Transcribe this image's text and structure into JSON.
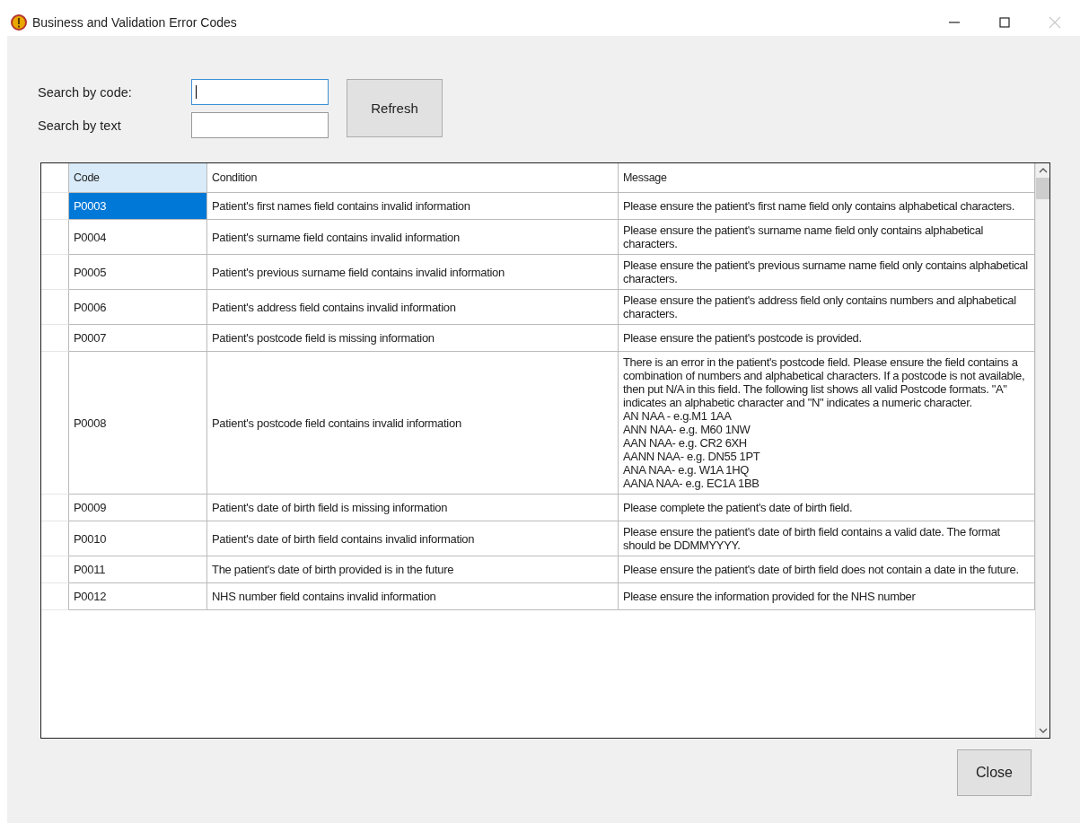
{
  "window": {
    "title": "Business and Validation Error Codes"
  },
  "search": [
    {
      "label": "Search by code:",
      "focused": true
    },
    {
      "label": "Search by text",
      "focused": false
    }
  ],
  "refresh_button": "Refresh",
  "table": {
    "columns": [
      {
        "label": "Code",
        "selected": true
      },
      {
        "label": "Condition",
        "selected": false
      },
      {
        "label": "Message",
        "selected": false
      }
    ],
    "rows": [
      {
        "code": "P0003",
        "condition": "Patient's first names field contains invalid information",
        "message": "Please ensure the patient's first name field only contains alphabetical characters.",
        "selected": true
      },
      {
        "code": "P0004",
        "condition": "Patient's surname field contains invalid information",
        "message": "Please ensure the patient's surname name field only contains alphabetical characters.",
        "selected": false
      },
      {
        "code": "P0005",
        "condition": "Patient's previous surname field contains invalid information",
        "message": "Please ensure the patient's previous surname name field only contains alphabetical characters.",
        "selected": false
      },
      {
        "code": "P0006",
        "condition": "Patient's address field contains invalid information",
        "message": "Please ensure the patient's address field only contains numbers and alphabetical characters.",
        "selected": false
      },
      {
        "code": "P0007",
        "condition": "Patient's postcode field is missing information",
        "message": "Please ensure the patient's postcode is provided.",
        "selected": false
      },
      {
        "code": "P0008",
        "condition": "Patient's postcode field contains invalid information",
        "message": "There is an error in the patient's postcode field. Please ensure the field contains a combination of numbers and alphabetical characters. If a postcode is not available, then put N/A in this field. The following list shows all valid Postcode formats. \"A\" indicates an alphabetic character and \"N\" indicates a numeric character.\nAN NAA - e.g.M1 1AA\nANN NAA- e.g. M60 1NW\nAAN NAA- e.g. CR2 6XH\nAANN NAA- e.g. DN55 1PT\nANA NAA- e.g. W1A 1HQ\nAANA NAA- e.g.  EC1A 1BB",
        "selected": false
      },
      {
        "code": "P0009",
        "condition": "Patient's date of birth field is missing information",
        "message": "Please complete the patient's date of birth field.",
        "selected": false
      },
      {
        "code": "P0010",
        "condition": "Patient's date of birth field contains invalid information",
        "message": "Please ensure the patient's date of birth field contains a valid date. The format should be DDMMYYYY.",
        "selected": false
      },
      {
        "code": "P0011",
        "condition": "The patient's date of birth provided is in the future",
        "message": "Please ensure the patient's date of birth field does not contain a date in the future.",
        "selected": false
      },
      {
        "code": "P0012",
        "condition": "NHS number field contains invalid information",
        "message": "Please ensure the information provided for the NHS number",
        "selected": false
      }
    ]
  },
  "close_button": "Close"
}
